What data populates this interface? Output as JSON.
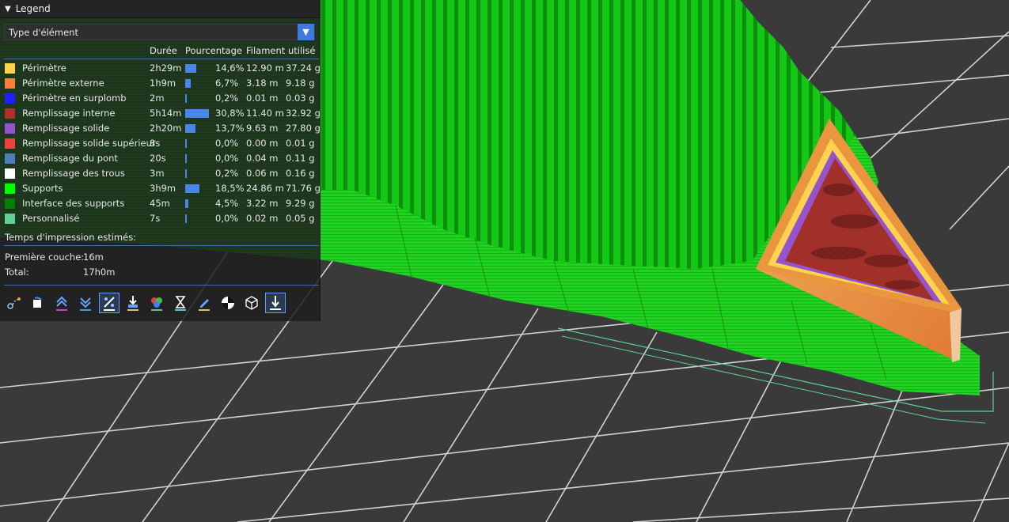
{
  "legend": {
    "title": "Legend",
    "select_value": "Type d'élément",
    "headers": {
      "duration": "Durée",
      "percentage": "Pourcentage",
      "filament": "Filament utilisé"
    },
    "rows": [
      {
        "label": "Périmètre",
        "color": "#ffd34d",
        "duration": "2h29m",
        "percent": "14,6%",
        "pct": 14.6,
        "length": "12.90 m",
        "weight": "37.24 g"
      },
      {
        "label": "Périmètre externe",
        "color": "#ff7d38",
        "duration": "1h9m",
        "percent": "6,7%",
        "pct": 6.7,
        "length": "3.18 m",
        "weight": "9.18 g"
      },
      {
        "label": "Périmètre en surplomb",
        "color": "#1f1fff",
        "duration": "2m",
        "percent": "0,2%",
        "pct": 0.2,
        "length": "0.01 m",
        "weight": "0.03 g"
      },
      {
        "label": "Remplissage interne",
        "color": "#b03029",
        "duration": "5h14m",
        "percent": "30,8%",
        "pct": 30.8,
        "length": "11.40 m",
        "weight": "32.92 g"
      },
      {
        "label": "Remplissage solide",
        "color": "#9654cc",
        "duration": "2h20m",
        "percent": "13,7%",
        "pct": 13.7,
        "length": "9.63 m",
        "weight": "27.80 g"
      },
      {
        "label": "Remplissage solide supérieur",
        "color": "#f04040",
        "duration": "8s",
        "percent": "0,0%",
        "pct": 0.0,
        "length": "0.00 m",
        "weight": "0.01 g"
      },
      {
        "label": "Remplissage du pont",
        "color": "#4d80ba",
        "duration": "20s",
        "percent": "0,0%",
        "pct": 0.0,
        "length": "0.04 m",
        "weight": "0.11 g"
      },
      {
        "label": "Remplissage des trous",
        "color": "#ffffff",
        "duration": "3m",
        "percent": "0,2%",
        "pct": 0.2,
        "length": "0.06 m",
        "weight": "0.16 g"
      },
      {
        "label": "Supports",
        "color": "#00ff00",
        "duration": "3h9m",
        "percent": "18,5%",
        "pct": 18.5,
        "length": "24.86 m",
        "weight": "71.76 g"
      },
      {
        "label": "Interface des supports",
        "color": "#008000",
        "duration": "45m",
        "percent": "4,5%",
        "pct": 4.5,
        "length": "3.22 m",
        "weight": "9.29 g"
      },
      {
        "label": "Personnalisé",
        "color": "#5ed194",
        "duration": "7s",
        "percent": "0,0%",
        "pct": 0.0,
        "length": "0.02 m",
        "weight": "0.05 g"
      }
    ],
    "estimates_title": "Temps d'impression estimés:",
    "first_layer_label": "Première couche:",
    "first_layer_value": "16m",
    "total_label": "Total:",
    "total_value": "17h0m"
  },
  "toolbar": {
    "icons": [
      "travel-icon",
      "wipe-icon",
      "retractions-icon",
      "deretractions-icon",
      "seams-icon",
      "tool-changes-icon",
      "color-changes-icon",
      "pause-icon",
      "custom-gcode-icon",
      "center-of-gravity-icon",
      "shells-icon",
      "tool-marker-icon"
    ]
  },
  "colors": {
    "accent": "#3d7ae0",
    "bed": "#3a3a3a",
    "grid": "#e8e8e8",
    "support": "#1fd41f"
  }
}
